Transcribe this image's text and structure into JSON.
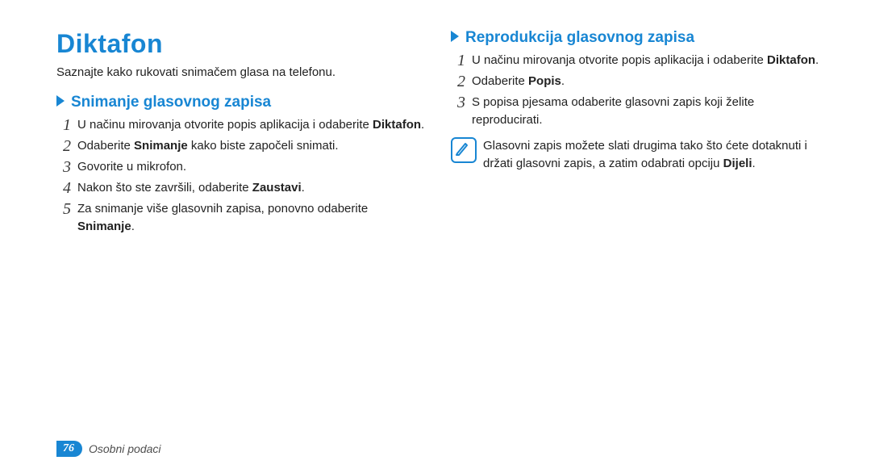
{
  "left": {
    "title": "Diktafon",
    "intro": "Saznajte kako rukovati snimačem glasa na telefonu.",
    "subhead": "Snimanje glasovnog zapisa",
    "steps": {
      "s1_pre": "U načinu mirovanja otvorite popis aplikacija i odaberite ",
      "s1_bold": "Diktafon",
      "s1_post": ".",
      "s2_pre": "Odaberite ",
      "s2_bold": "Snimanje",
      "s2_post": " kako biste započeli snimati.",
      "s3": "Govorite u mikrofon.",
      "s4_pre": "Nakon što ste završili, odaberite ",
      "s4_bold": "Zaustavi",
      "s4_post": ".",
      "s5_pre": "Za snimanje više glasovnih zapisa, ponovno odaberite ",
      "s5_bold": "Snimanje",
      "s5_post": "."
    }
  },
  "right": {
    "subhead": "Reprodukcija glasovnog zapisa",
    "steps": {
      "s1_pre": "U načinu mirovanja otvorite popis aplikacija i odaberite ",
      "s1_bold": "Diktafon",
      "s1_post": ".",
      "s2_pre": "Odaberite ",
      "s2_bold": "Popis",
      "s2_post": ".",
      "s3": "S popisa pjesama odaberite glasovni zapis koji želite reproducirati."
    },
    "note_pre": "Glasovni zapis možete slati drugima tako što ćete dotaknuti i držati glasovni zapis, a zatim odabrati opciju ",
    "note_bold": "Dijeli",
    "note_post": "."
  },
  "footer": {
    "pagenum": "76",
    "section": "Osobni podaci"
  },
  "nums": {
    "n1": "1",
    "n2": "2",
    "n3": "3",
    "n4": "4",
    "n5": "5"
  }
}
